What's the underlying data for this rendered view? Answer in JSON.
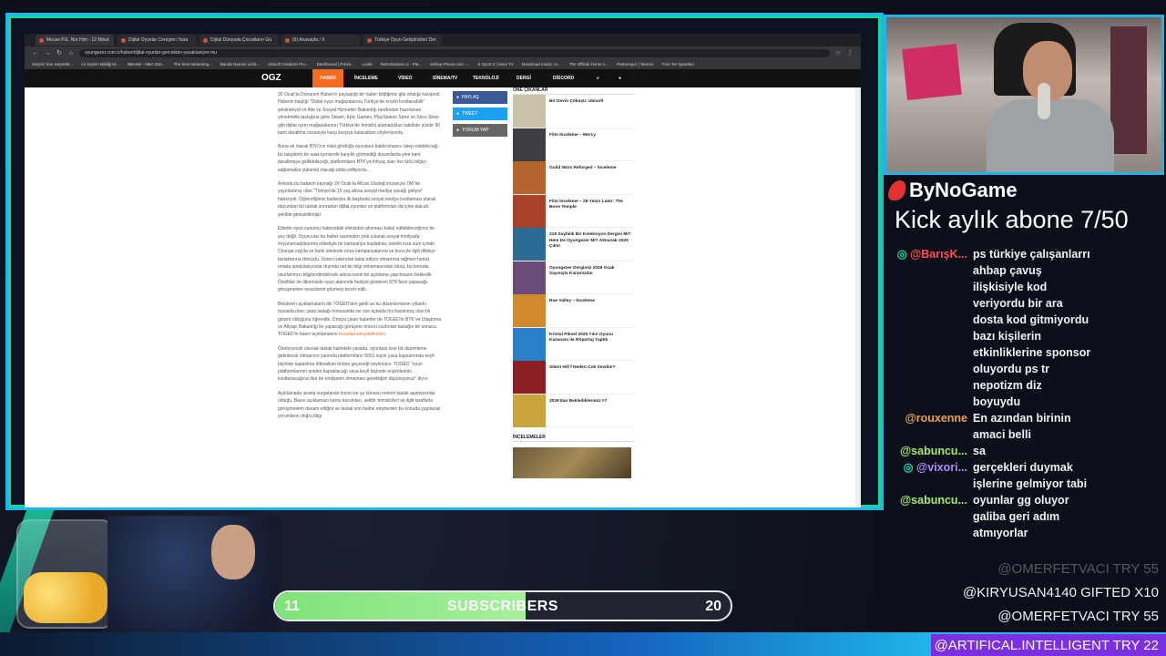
{
  "browser": {
    "tabs": [
      {
        "label": "Mouse P.E. Nor Him - 12 Minut"
      },
      {
        "label": "Dijital Oyunlar Cereşten Yasa"
      },
      {
        "label": "Dijital Dünyada Çocukların Gü"
      },
      {
        "label": "(6) Anasayfa / X"
      },
      {
        "label": "Türkiye Oyun Geliştiricileri Der"
      }
    ],
    "url": "oyungezer.com.tr/haber/dijital-oyunlar-gercekten-yasaklaniyor-mu",
    "bookmarks": [
      "Sürpriz Son Seyretle...",
      "Az Kişinin Bildiği M...",
      "NBAMe - NBA Stre...",
      "The best streaming...",
      "Banda Namos Limb...",
      "Ubisoft Creators Pro...",
      "Dashboard | Presti...",
      "Lunkt",
      "RetroGames.cc - Pla...",
      "eShop-Prices.com -...",
      "S Sport 2 | Zeus TV",
      "Download music, m...",
      "The Official Home o...",
      "Patronspor | Tanıtım",
      "Tüm Yer İşaretleri"
    ]
  },
  "site": {
    "logo": "OGZ",
    "nav": [
      "HABER",
      "İNCELEME",
      "VİDEO",
      "SİNEMA/TV",
      "TEKNOLOJİ",
      "DERGİ",
      "DİSCORD"
    ],
    "active_nav": "HABER",
    "article_paragraphs": [
      "30 Ocak'ta Donanım Haber'in paylaştığı bir haber bildiğimiz gibi ortalığı karıştırdı. Haberin başlığı \"Dijital oyun mağazalarına Türkiye'de erişim kısıtlanabilir\" şeklindeydi ve Aile ve Sosyal Hizmetler Bakanlığı tarafından hazırlanan yönetmelik taslağına göre Steam, Epic Games, PlayStation Store ve Xbox Store gibi dijital oyun mağazalarının Türkiye'de temsilci atamadıkları takdirde yüzde 90 bant daraltma cezasıyla karşı karşıya kalacakları söyleniyordu.",
      "Buna ek olarak BTK'nın riskli gördüğü oyunların kaldırılmasını talep edebileceği, bu taleplerin bir saat içerisinde karşılık görmediği durumlarda yine bant daraltmaya gidilebileceği, platformların BTK'ya ihtiyaç olan her türlü bilgiyi sağlamakla yükümlü olacağı iddia ediliyordu.",
      "Aslında bu haberin kaynağı 29 Ocak'ta Alican Uludağ imzasıyla DW'de yayınlanmış olan \"Türkiye'de 15 yaş altına sosyal medya yasağı geliyor\" haberiydi. Öğrendiğimiz kadarıyla ilk başlarda sosyal medya kısıtlaması olarak duyurulan bu taslak sonradan dijital oyunları ve platformları da içine alacak şekilde genişletilmişti.",
      "Elbette oyun sunumu hakkındaki elimizden alınması kabul edilebileceğimiz bir şey değil. Oyuncular bu haber üzerinden yola çıkarak sosyal medyada #oyunumadokunma etiketiyle bir kampanya başlattılar, üstelik kısa süre içinde Change.org'da ve farklı sitelerde imza kampanyalarına ve konu ile ilgili dilekçe taslaklarına dönüştü. Süreci yakından takip ediyor olmamıza rağmen henüz ortada spekülasyonlar dışında net bir bilgi olmamasından ötürü, bu konuda okurlarımızı bilgilendirebilmek adına resmi bir açıklama yapılmasını bekledik. Özellikle de ülkemizde oyun alanında faaliyet gösteren STK'ların yapacağı görüşmelere sessizlerin gözmeyi tercih ettik.",
      "Beklenen açıklamaların ilki TOGED'den geldi ve bu düzenlemenin yıllardır masada olan, yasa taslağı konusunda ise son aylarda hız kazanmış olan bir girişim olduğunu öğrendik. Ortaya çıkan haberler de TOGED'in BTK ve Ulaştırma ve Altyapı Bakanlığı ile yapacağı görüşme öncesi sızdırılan taslağın bir sonucu. TOGED'in basın açıklamasını",
      "Özetleyecek olursak taslak halindeki yasada, oyunlara özel bir düzenleme getirilecek olmasının yanında platformların 5651 sayılı yasa kapsamında keyfi biçimde kapatılma ihtimalinin önüne geçeceği söyleniyor. TOGED \"oyun platformlarının aniden kapatılacağı veya keyfi biçimde erişimlerinin kısıtlanacağına dair bir endişenin olmaması gerektiğini düşünüyoruz\" diyor.",
      "Açıklamada ısrarla vurgulanan kısım ise şu konusu metnin taslak aşamasında olduğu. Basın açıklaması kamu kurumları, sektör temsilcileri ve ilgili taraflarla görüşmelerin devam ettiğini ve taslak son haline erişmeden bu konuda yapılacak yorumların doğru bilgi"
    ],
    "article_link": "buradan okuyabilirsiniz.",
    "share_buttons": [
      {
        "label": "PAYLAŞ",
        "color": "#3b5998"
      },
      {
        "label": "TWEET",
        "color": "#1da1f2"
      },
      {
        "label": "YORUM YAP",
        "color": "#666666"
      }
    ],
    "sidebar_heading": "ÖNE ÇIKANLAR",
    "sidebar_items": [
      {
        "title": "Bir Devin Çöküşü: Ubisoft",
        "color": "#c9c2a8"
      },
      {
        "title": "Film İnceleme – Mercy",
        "color": "#3d3f44"
      },
      {
        "title": "Guild Wars Reforged – İnceleme",
        "color": "#b5642d"
      },
      {
        "title": "Film İnceleme – 28 Years Later: The Bone Temple",
        "color": "#a8422a"
      },
      {
        "title": "218 Sayfalık Bir Koleksiyon Dergisi Mi? Hem De Oyungezer Mi? Almanak 2025 Çıktı!",
        "color": "#2b6a92"
      },
      {
        "title": "Oyungezer Dergimiz 2026 Ocak Sayısıyla Karşınızda!",
        "color": "#6b4b7a"
      },
      {
        "title": "Rue Valley – İnceleme",
        "color": "#d18a2c"
      },
      {
        "title": "Kristal Piksel 2025 Yılın Oyunu Kazananı ile Röportaj Yaptık",
        "color": "#2a7fc9"
      },
      {
        "title": "Silent Hill f Neden Çok Sevdim?",
        "color": "#8a1f24"
      },
      {
        "title": "2026'dan Beklediklerimiz #7",
        "color": "#c8a63b"
      }
    ],
    "reviews_heading": "İNCELEMELER"
  },
  "overlay": {
    "brand": "ByNoGame",
    "kick_goal": "Kick aylık abone 7/50",
    "chat": [
      {
        "user": "@BarışK...",
        "user_color": "#ff4d4d",
        "badge": true,
        "text": "ps türkiye çalışanlarrı ahbap çavuş ilişkisiyle kod veriyordu bir ara dosta kod gitmiyordu bazı kişilerin etkinliklerine sponsor oluyordu ps tr nepotizm diz boyuydu"
      },
      {
        "user": "@rouxenne",
        "user_color": "#f0a04b",
        "badge": false,
        "text": "En azından birinin amaci belli"
      },
      {
        "user": "@sabuncu...",
        "user_color": "#a5e86b",
        "badge": false,
        "text": "sa"
      },
      {
        "user": "@vixori...",
        "user_color": "#b38cff",
        "badge": true,
        "text": "gerçekleri duymak işlerine gelmiyor tabi"
      },
      {
        "user": "@sabuncu...",
        "user_color": "#a5e86b",
        "badge": false,
        "text": "oyunlar gg oluyor galiba geri adım atmıyorlar"
      }
    ],
    "subscribers": {
      "label": "SUBSCRIBERS",
      "current": "11",
      "goal": "20",
      "progress": 0.55
    },
    "events": [
      {
        "text": "@OMERFETVACI TRY 55",
        "faded": true
      },
      {
        "text": "@KIRYUSAN4140 GIFTED X10",
        "faded": false
      },
      {
        "text": "@OMERFETVACI TRY 55",
        "faded": false
      }
    ],
    "event_highlight": "@ARTIFICAL.INTELLIGENT TRY 22",
    "colors": {
      "frame_blue": "#1fb5e8",
      "frame_teal": "#19d3a0",
      "highlight_purple": "#7a2fe0"
    }
  }
}
